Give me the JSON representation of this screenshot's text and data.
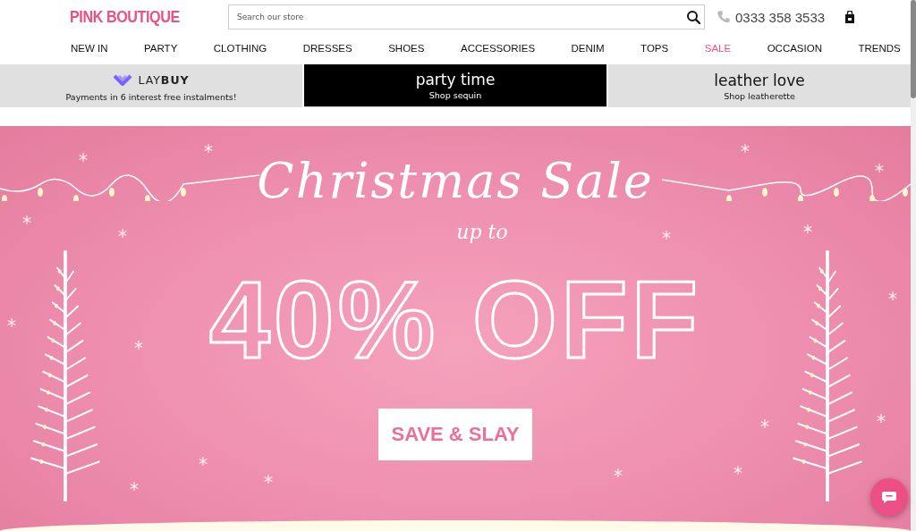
{
  "header": {
    "logo": "PINK BOUTIQUE",
    "search": {
      "placeholder": "Search our store"
    },
    "phone": "0333 358 3533"
  },
  "nav": [
    {
      "label": "NEW IN",
      "color": "#111111"
    },
    {
      "label": "PARTY",
      "color": "#111111"
    },
    {
      "label": "CLOTHING",
      "color": "#111111"
    },
    {
      "label": "DRESSES",
      "color": "#111111"
    },
    {
      "label": "SHOES",
      "color": "#111111"
    },
    {
      "label": "ACCESSORIES",
      "color": "#111111"
    },
    {
      "label": "DENIM",
      "color": "#111111"
    },
    {
      "label": "TOPS",
      "color": "#111111"
    },
    {
      "label": "SALE",
      "color": "#ec4f86"
    },
    {
      "label": "OCCASION",
      "color": "#111111"
    },
    {
      "label": "TRENDS",
      "color": "#111111"
    }
  ],
  "promos": [
    {
      "kind": "laybuy",
      "brand_light": "LAY",
      "brand_bold": "BUY",
      "subtitle": "Payments in 6 interest free instalments!"
    },
    {
      "kind": "dark",
      "title": "party time",
      "subtitle": "Shop sequin"
    },
    {
      "kind": "light",
      "title": "leather love",
      "subtitle": "Shop leatherette"
    }
  ],
  "hero": {
    "script_title": "Christmas Sale",
    "script_sub": "up to",
    "headline": "40% OFF",
    "cta": "SAVE & SLAY"
  }
}
